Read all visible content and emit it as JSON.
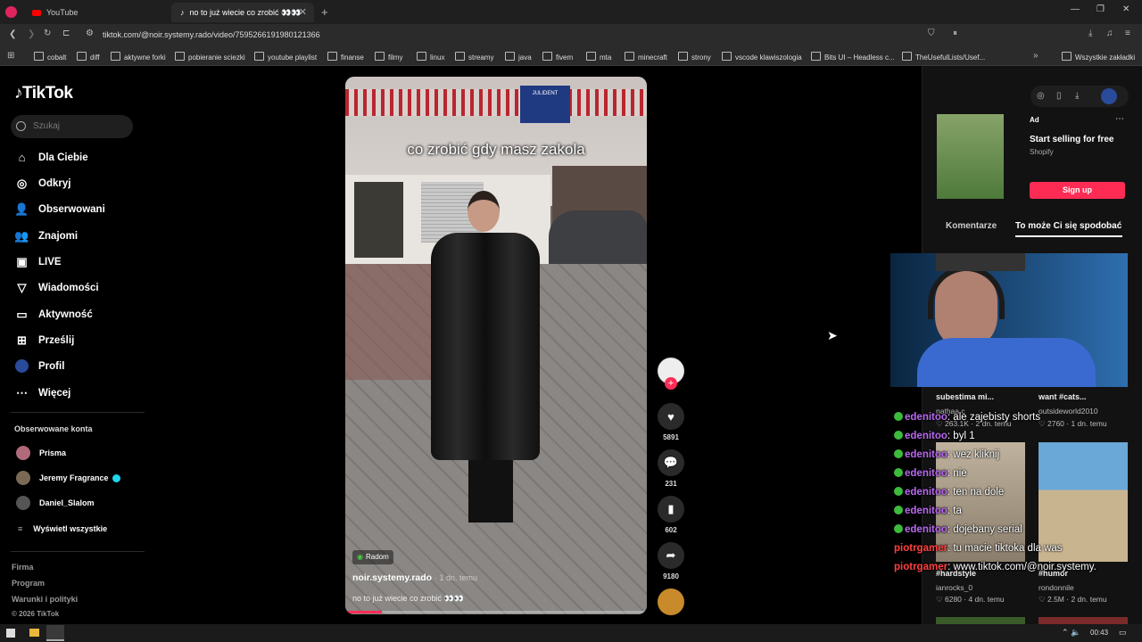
{
  "browser": {
    "tabs": [
      {
        "label": "YouTube"
      },
      {
        "label": "no to już wiecie co zrobić 👀👀"
      }
    ],
    "new_tab": "+",
    "url": "tiktok.com/@noir.systemy.rado/video/7595266191980121366",
    "bookmarks": [
      "cobalt",
      "diff",
      "aktywne forki",
      "pobieranie sciezki",
      "youtube playlist",
      "finanse",
      "filmy",
      "linux",
      "streamy",
      "java",
      "fivem",
      "mta",
      "minecraft",
      "strony",
      "vscode klawiszologia",
      "Bits UI – Headless c...",
      "TheUsefulLists/Usef...",
      "Wszystkie zakładki"
    ]
  },
  "tiktok": {
    "logo": "TikTok",
    "search_placeholder": "Szukaj",
    "nav": [
      {
        "label": "Dla Ciebie",
        "icon": "home-icon"
      },
      {
        "label": "Odkryj",
        "icon": "compass-icon"
      },
      {
        "label": "Obserwowani",
        "icon": "following-icon"
      },
      {
        "label": "Znajomi",
        "icon": "friends-icon"
      },
      {
        "label": "LIVE",
        "icon": "live-icon"
      },
      {
        "label": "Wiadomości",
        "icon": "messages-icon"
      },
      {
        "label": "Aktywność",
        "icon": "activity-icon"
      },
      {
        "label": "Prześlij",
        "icon": "upload-icon"
      },
      {
        "label": "Profil",
        "icon": "profile-icon"
      },
      {
        "label": "Więcej",
        "icon": "more-icon"
      }
    ],
    "following_title": "Obserwowane konta",
    "following": [
      "Prisma",
      "Jeremy Fragrance",
      "Daniel_Slalom"
    ],
    "see_all": "Wyświetl wszystkie",
    "footer": [
      "Firma",
      "Program",
      "Warunki i polityki",
      "© 2026 TikTok"
    ]
  },
  "video": {
    "caption_overlay": "co zrobić gdy masz zakola",
    "location": "Radom",
    "author": "noir.systemy.rado",
    "age": "· 1 dn. temu",
    "description": "no to już wiecie co zrobić 👀👀",
    "sign_text": "JULIDENT",
    "likes": "5891",
    "comments": "231",
    "saves": "602",
    "shares": "9180",
    "progress": 0.12
  },
  "right": {
    "ad_label": "Ad",
    "ad_title": "Start selling for free",
    "ad_brand": "Shopify",
    "ad_button": "Sign up",
    "tabs": [
      "Komentarze",
      "To może Ci się spodobać"
    ],
    "cards": [
      {
        "title": "subestima mi...",
        "author": "nathaa.c",
        "views": "263.1K",
        "age": "2 dn. temu"
      },
      {
        "title": "want #cats...",
        "author": "outsideworld2010",
        "views": "2760",
        "age": "1 dn. temu"
      },
      {
        "title": "#hardstyle",
        "author": "ianrocks_0",
        "views": "6280",
        "age": "4 dn. temu"
      },
      {
        "title": "#humor",
        "author": "rondonnile",
        "views": "2.5M",
        "age": "2 dn. temu"
      }
    ]
  },
  "chat": [
    {
      "user": "edenitoo",
      "msg": ": ale zajebisty shorts",
      "mod": true
    },
    {
      "user": "edenitoo",
      "msg": ": byl 1",
      "mod": true
    },
    {
      "user": "edenitoo",
      "msg": ": wez kliknij",
      "mod": true
    },
    {
      "user": "edenitoo",
      "msg": ": nie",
      "mod": true
    },
    {
      "user": "edenitoo",
      "msg": ": ten na dole",
      "mod": true
    },
    {
      "user": "edenitoo",
      "msg": ": ta",
      "mod": true
    },
    {
      "user": "edenitoo",
      "msg": ": dojebany serial",
      "mod": true
    },
    {
      "user": "piotrgamer",
      "msg": ": tu macie tiktoka dla was",
      "mod": false
    },
    {
      "user": "piotrgamer",
      "msg": ": www.tiktok.com/@noir.systemy.",
      "mod": false
    }
  ],
  "taskbar": {
    "time": "00:43"
  },
  "colors": {
    "accent": "#fe2c55",
    "mod_badge": "#3cbc3c",
    "chat_user": "#b868f0",
    "chat_user2": "#ff4040"
  }
}
